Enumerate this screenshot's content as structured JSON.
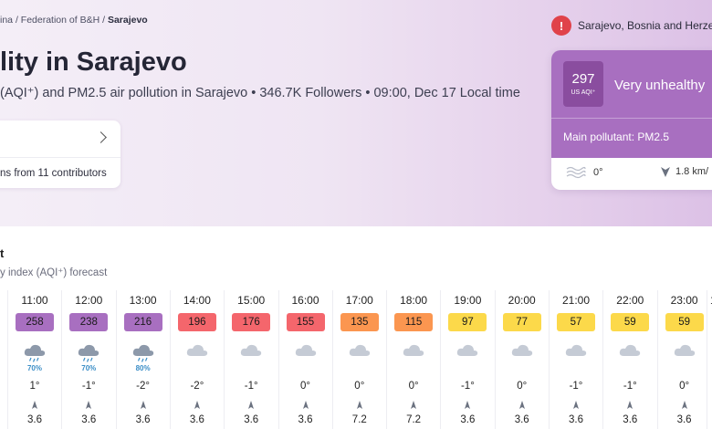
{
  "breadcrumb": {
    "part1": "ina",
    "part2": "Federation of B&H",
    "current": "Sarajevo",
    "sep": "/"
  },
  "title": "lity in Sarajevo",
  "subtitle": "(AQI⁺) and PM2.5 air pollution in Sarajevo • 346.7K Followers • 09:00, Dec 17 Local time",
  "contributors": {
    "text": "ns from 11 contributors"
  },
  "location": {
    "label": "Sarajevo, Bosnia and Herzeg"
  },
  "aqi_card": {
    "value": "297",
    "unit": "US AQI⁺",
    "status": "Very unhealthy",
    "pollutant": "Main pollutant: PM2.5",
    "temp": "0°",
    "wind": "1.8 km/",
    "color": "#a86fc0"
  },
  "forecast": {
    "title": "t",
    "subtitle": "y index (AQI⁺) forecast",
    "partial_time": "1",
    "hours": [
      {
        "time": "11:00",
        "aqi": "258",
        "color": "#a86fc0",
        "weather": "rain-cloud-icon",
        "rain": "70%",
        "temp": "1°",
        "wind": "3.6"
      },
      {
        "time": "12:00",
        "aqi": "238",
        "color": "#a86fc0",
        "weather": "rain-cloud-icon",
        "rain": "70%",
        "temp": "-1°",
        "wind": "3.6"
      },
      {
        "time": "13:00",
        "aqi": "216",
        "color": "#a86fc0",
        "weather": "rain-cloud-icon",
        "rain": "80%",
        "temp": "-2°",
        "wind": "3.6"
      },
      {
        "time": "14:00",
        "aqi": "196",
        "color": "#f4666c",
        "weather": "cloud-icon",
        "rain": "",
        "temp": "-2°",
        "wind": "3.6"
      },
      {
        "time": "15:00",
        "aqi": "176",
        "color": "#f4666c",
        "weather": "cloud-icon",
        "rain": "",
        "temp": "-1°",
        "wind": "3.6"
      },
      {
        "time": "16:00",
        "aqi": "155",
        "color": "#f4666c",
        "weather": "cloud-icon",
        "rain": "",
        "temp": "0°",
        "wind": "3.6"
      },
      {
        "time": "17:00",
        "aqi": "135",
        "color": "#fb9650",
        "weather": "cloud-icon",
        "rain": "",
        "temp": "0°",
        "wind": "7.2"
      },
      {
        "time": "18:00",
        "aqi": "115",
        "color": "#fb9650",
        "weather": "cloud-icon",
        "rain": "",
        "temp": "0°",
        "wind": "7.2"
      },
      {
        "time": "19:00",
        "aqi": "97",
        "color": "#fcd94a",
        "weather": "cloud-icon",
        "rain": "",
        "temp": "-1°",
        "wind": "3.6"
      },
      {
        "time": "20:00",
        "aqi": "77",
        "color": "#fcd94a",
        "weather": "cloud-icon",
        "rain": "",
        "temp": "0°",
        "wind": "3.6"
      },
      {
        "time": "21:00",
        "aqi": "57",
        "color": "#fcd94a",
        "weather": "cloud-icon",
        "rain": "",
        "temp": "-1°",
        "wind": "3.6"
      },
      {
        "time": "22:00",
        "aqi": "59",
        "color": "#fcd94a",
        "weather": "cloud-icon",
        "rain": "",
        "temp": "-1°",
        "wind": "3.6"
      },
      {
        "time": "23:00",
        "aqi": "59",
        "color": "#fcd94a",
        "weather": "cloud-icon",
        "rain": "",
        "temp": "0°",
        "wind": "3.6"
      }
    ]
  }
}
